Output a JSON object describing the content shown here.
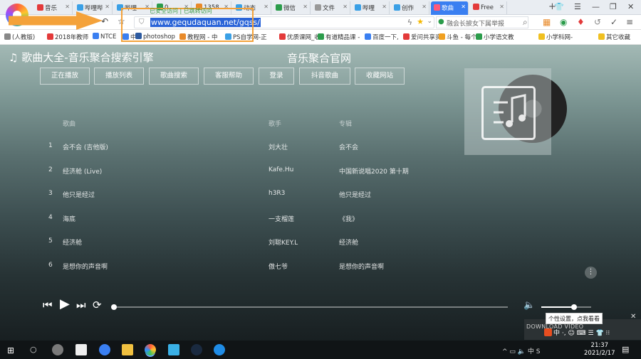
{
  "browser": {
    "tabs": [
      {
        "label": "音乐",
        "color": "#e33a3a"
      },
      {
        "label": "哔哩哔",
        "color": "#3aa0e6"
      },
      {
        "label": "哔哩",
        "color": "#3aa0e6"
      },
      {
        "label": "0",
        "color": "#2b9c4b"
      },
      {
        "label": "1358",
        "color": "#e88a2a"
      },
      {
        "label": "动态",
        "color": "#3aa0e6"
      },
      {
        "label": "微信",
        "color": "#2b9c4b"
      },
      {
        "label": "文件",
        "color": "#999999"
      },
      {
        "label": "哔哩",
        "color": "#3aa0e6"
      },
      {
        "label": "创作",
        "color": "#3aa0e6"
      },
      {
        "label": "歌曲",
        "color": "#ff5a7a",
        "active": true
      },
      {
        "label": "Free",
        "color": "#e33a3a"
      }
    ],
    "new_tab": "+",
    "url": "www.gequdaquan.net/gqss/",
    "url_annotation": "已安全访问 | 已跳转访问",
    "search_placeholder": "融会长披女下属举报",
    "bookmarks": [
      {
        "label": "(人教版)",
        "color": "#888888"
      },
      {
        "label": "2018年教师",
        "color": "#e33a3a"
      },
      {
        "label": "NTCE",
        "color": "#3a7ff1"
      },
      {
        "label": "中",
        "color": "#3a7ff1"
      },
      {
        "label": "photoshop",
        "color": "#2c5aa0"
      },
      {
        "label": "教程网 - 中",
        "color": "#e88a2a"
      },
      {
        "label": "PS自学网-正",
        "color": "#3aa0e6"
      },
      {
        "label": "优质课网_收",
        "color": "#e33a3a"
      },
      {
        "label": "有道精品课 -",
        "color": "#2b9c4b"
      },
      {
        "label": "百度一下,",
        "color": "#3a7ff1"
      },
      {
        "label": "爱问共享资",
        "color": "#e33a3a"
      },
      {
        "label": "斗鱼 - 每个",
        "color": "#f0a020"
      },
      {
        "label": "小学语文教",
        "color": "#2b9c4b"
      },
      {
        "label": "小学科网-",
        "color": "#f0c020"
      },
      {
        "label": "其它收藏",
        "color": "#f0c020"
      }
    ]
  },
  "app": {
    "title": "♫ 歌曲大全-音乐聚合搜索引擎",
    "subtitle": "音乐聚合官网",
    "nav": [
      "正在播放",
      "播放列表",
      "歌曲搜索",
      "客服帮助",
      "登录",
      "抖音歌曲",
      "收藏网站"
    ],
    "columns": {
      "song": "歌曲",
      "singer": "歌手",
      "album": "专辑"
    },
    "songs": [
      {
        "no": "1",
        "song": "会不会 (吉他版)",
        "singer": "刘大壮",
        "album": "会不会"
      },
      {
        "no": "2",
        "song": "经济舱 (Live)",
        "singer": "Kafe.Hu",
        "album": "中国新说唱2020 第十期"
      },
      {
        "no": "3",
        "song": "他只是经过",
        "singer": "h3R3",
        "album": "他只是经过"
      },
      {
        "no": "4",
        "song": "海底",
        "singer": "一支榴莲",
        "album": "《我》"
      },
      {
        "no": "5",
        "song": "经济舱",
        "singer": "刘聪KEY.L",
        "album": "经济舱"
      },
      {
        "no": "6",
        "song": "是想你的声音啊",
        "singer": "傲七爷",
        "album": "是想你的声音啊"
      }
    ],
    "more": "⋮",
    "progress": 0,
    "volume": 0.65,
    "tooltip": "个性设置，点我看看",
    "widget_title": "DOWNLOAD VIDEO",
    "ime": "中 ·, ☺ ⌨ ☰ 👕 ⁝⁝"
  },
  "taskbar": {
    "time": "21:37",
    "date": "2021/2/17",
    "tray": "^ ▭ 🔈 中 S"
  }
}
